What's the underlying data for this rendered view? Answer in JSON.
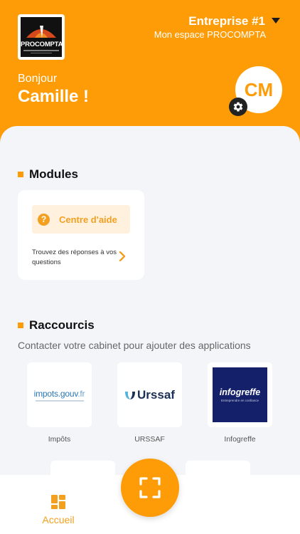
{
  "header": {
    "logo_text": "PROCOMPTA",
    "company_name": "Entreprise #1",
    "space_label": "Mon espace PROCOMPTA",
    "greeting": "Bonjour",
    "user_name": "Camille !",
    "avatar_initials": "CM"
  },
  "modules": {
    "title": "Modules",
    "help_button_label": "Centre d'aide",
    "help_icon_glyph": "?",
    "help_description": "Trouvez des réponses à vos questions"
  },
  "shortcuts": {
    "title": "Raccourcis",
    "subtitle": "Contacter votre cabinet pour ajouter des applications",
    "items": [
      {
        "label": "Impôts",
        "logo_text": "impots.gouv",
        "logo_suffix": ".fr"
      },
      {
        "label": "URSSAF",
        "logo_text": "Urssaf"
      },
      {
        "label": "Infogreffe",
        "logo_text": "infogreffe",
        "logo_tagline": "Entreprendre en confiance"
      }
    ]
  },
  "tabbar": {
    "home_label": "Accueil"
  },
  "colors": {
    "brand_orange": "#fe9c08",
    "accent_orange": "#f3a021",
    "background": "#f4f5f8",
    "infogreffe_navy": "#14206a"
  }
}
